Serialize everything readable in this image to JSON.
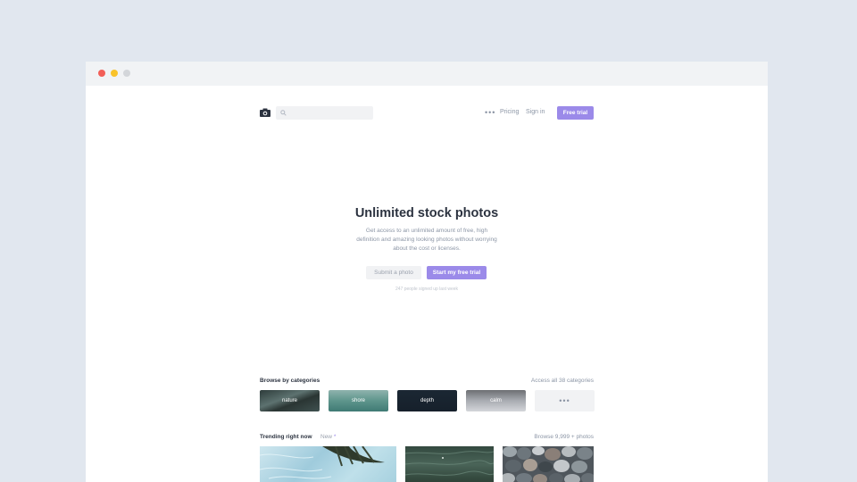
{
  "window": {
    "controls": [
      "close",
      "minimize",
      "zoom"
    ]
  },
  "header": {
    "logo_icon": "camera-icon",
    "search": {
      "placeholder": "",
      "icon": "search-icon"
    },
    "more_label": "•••",
    "pricing_label": "Pricing",
    "signin_label": "Sign in",
    "free_trial_label": "Free trial"
  },
  "hero": {
    "title": "Unlimited stock photos",
    "description": "Get access to an unlimited amount of free, high definition and amazing looking photos without worrying about the cost or licenses.",
    "submit_label": "Submit a photo",
    "start_label": "Start my free trial",
    "signed_up_text": "247 people signed up last week"
  },
  "categories": {
    "title": "Browse by categories",
    "link_label": "Access all 38 categories",
    "items": [
      {
        "label": "nature"
      },
      {
        "label": "shore"
      },
      {
        "label": "depth"
      },
      {
        "label": "calm"
      },
      {
        "label": "•••"
      }
    ]
  },
  "trending": {
    "title": "Trending right now",
    "new_label": "New",
    "new_marker": "*",
    "link_label": "Browse 9,999 + photos"
  },
  "colors": {
    "accent": "#9b8ae9",
    "background": "#e1e7ef",
    "text_dark": "#2c3340",
    "text_muted": "#8c96a6"
  }
}
